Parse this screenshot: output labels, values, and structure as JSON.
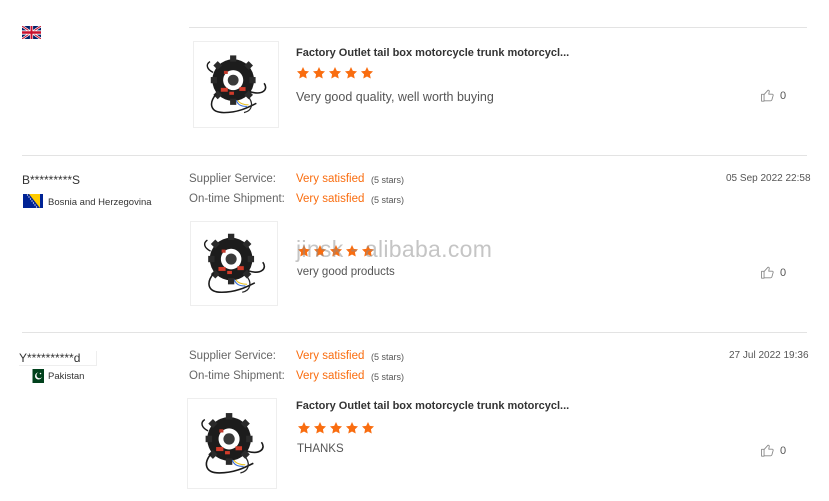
{
  "reviews": [
    {
      "product_title": "Factory Outlet tail box motorcycle trunk motorcycl...",
      "rating": 5,
      "text": "Very good quality, well worth buying",
      "likes": "0",
      "flag": "uk-flag"
    },
    {
      "username": "B*********S",
      "country": "Bosnia and Herzegovina",
      "flag": "bosnia-flag",
      "date": "05 Sep 2022 22:58",
      "supplier_service_label": "Supplier Service:",
      "supplier_service_value": "Very satisfied",
      "supplier_service_stars": "(5 stars)",
      "shipment_label": "On-time Shipment:",
      "shipment_value": "Very satisfied",
      "shipment_stars": "(5 stars)",
      "rating": 5,
      "text": "very good products",
      "likes": "0"
    },
    {
      "username": "Y**********d",
      "country": "Pakistan",
      "flag": "pakistan-flag",
      "date": "27 Jul 2022 19:36",
      "supplier_service_label": "Supplier Service:",
      "supplier_service_value": "Very satisfied",
      "supplier_service_stars": "(5 stars)",
      "shipment_label": "On-time Shipment:",
      "shipment_value": "Very satisfied",
      "shipment_stars": "(5 stars)",
      "product_title": "Factory Outlet tail box motorcycle trunk motorcycl...",
      "rating": 5,
      "text": "THANKS",
      "likes": "0"
    }
  ],
  "watermark": "jinsk - alibaba.com",
  "colors": {
    "accent": "#f96d10",
    "divider": "#e3e3e3"
  }
}
